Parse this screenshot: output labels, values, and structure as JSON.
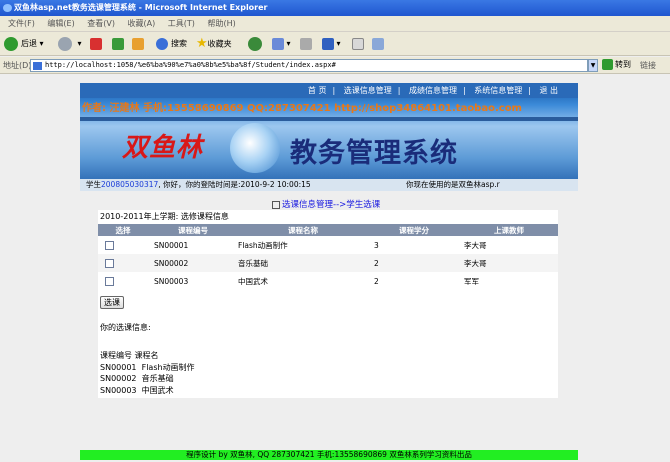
{
  "window": {
    "title": "双鱼林asp.net教务选课管理系统 - Microsoft Internet Explorer"
  },
  "menu": [
    "文件(F)",
    "编辑(E)",
    "查看(V)",
    "收藏(A)",
    "工具(T)",
    "帮助(H)"
  ],
  "toolbar": {
    "back": "后退",
    "search": "搜索",
    "favorites": "收藏夹"
  },
  "address": {
    "label": "地址(D)",
    "url": "http://localhost:1058/%e6%ba%90%e7%a0%8b%e5%ba%8f/Student/index.aspx#",
    "go": "转到",
    "links": "链接"
  },
  "banner": {
    "nav": [
      "首 页",
      "选课信息管理",
      "成绩信息管理",
      "系统信息管理",
      "退 出"
    ],
    "author": "作者: 汪建林  手机:13558690869 QQ:287307421 http://shop34864101.taobao.com",
    "brand": "双鱼林",
    "system": "教务管理系统",
    "status_prefix": "学生",
    "status_id": "200805030317",
    "status_rest": ", 你好，你的登陆时间是:2010-9-2 10:00:15",
    "status_right": "你现在使用的是双鱼林asp.r"
  },
  "breadcrumb": "选课信息管理-->学生选课",
  "term": "2010-2011年上学期:    选修课程信息",
  "table": {
    "headers": [
      "选择",
      "课程编号",
      "课程名称",
      "课程学分",
      "上课教师"
    ],
    "rows": [
      [
        "SN00001",
        "Flash动画制作",
        "3",
        "李大哥"
      ],
      [
        "SN00002",
        "音乐基础",
        "2",
        "李大哥"
      ],
      [
        "SN00003",
        "中国武术",
        "2",
        "军军"
      ]
    ]
  },
  "select_button": "选课",
  "my_selection_label": "你的选课信息:",
  "my_selection": "课程编号 课程名\nSN00001  Flash动画制作\nSN00002  音乐基础\nSN00003  中国武术",
  "footer": "程序设计 by 双鱼林, QQ  287307421 手机:13558690869 双鱼林系列学习资料出品"
}
